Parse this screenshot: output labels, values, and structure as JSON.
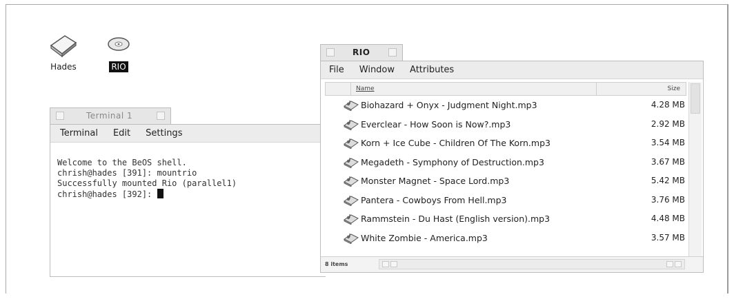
{
  "desktop": {
    "icons": [
      {
        "label": "Hades",
        "icon": "hard-disk-icon"
      },
      {
        "label": "RIO",
        "icon": "disc-icon",
        "selected": true
      }
    ]
  },
  "terminal": {
    "tab_title": "Terminal 1",
    "menu": [
      "Terminal",
      "Edit",
      "Settings"
    ],
    "lines": [
      "Welcome to the BeOS shell.",
      "",
      "chrish@hades [391]: mountrio",
      "Successfully mounted Rio (parallel1)",
      "chrish@hades [392]: "
    ]
  },
  "rio_window": {
    "tab_title": "RIO",
    "menu": [
      "File",
      "Window",
      "Attributes"
    ],
    "columns": {
      "name": "Name",
      "size": "Size"
    },
    "files": [
      {
        "name": "Biohazard + Onyx - Judgment Night.mp3",
        "size": "4.28 MB"
      },
      {
        "name": "Everclear - How Soon is Now?.mp3",
        "size": "2.92 MB"
      },
      {
        "name": "Korn + Ice Cube - Children Of The Korn.mp3",
        "size": "3.54 MB"
      },
      {
        "name": "Megadeth - Symphony of Destruction.mp3",
        "size": "3.67 MB"
      },
      {
        "name": "Monster Magnet - Space Lord.mp3",
        "size": "5.42 MB"
      },
      {
        "name": "Pantera - Cowboys From Hell.mp3",
        "size": "3.76 MB"
      },
      {
        "name": "Rammstein - Du Hast (English version).mp3",
        "size": "4.48 MB"
      },
      {
        "name": "White Zombie - America.mp3",
        "size": "3.57 MB"
      }
    ],
    "status": "8 items"
  }
}
